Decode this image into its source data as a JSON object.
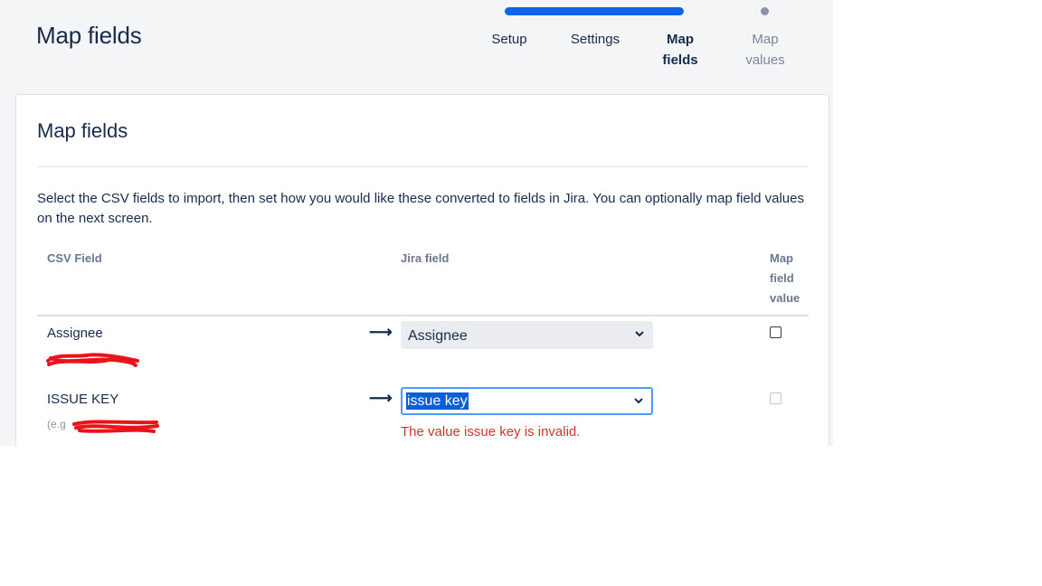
{
  "header": {
    "title": "Map fields"
  },
  "progress": {
    "steps": [
      {
        "label_line1": "Setup",
        "label_line2": "",
        "state": "done"
      },
      {
        "label_line1": "Settings",
        "label_line2": "",
        "state": "done"
      },
      {
        "label_line1": "Map",
        "label_line2": "fields",
        "state": "current"
      },
      {
        "label_line1": "Map",
        "label_line2": "values",
        "state": "upcoming"
      }
    ]
  },
  "card": {
    "title": "Map fields",
    "description": "Select the CSV fields to import, then set how you would like these converted to fields in Jira. You can optionally map field values on the next screen.",
    "columns": {
      "csv_field": "CSV Field",
      "jira_field": "Jira field",
      "map_value_line1": "Map",
      "map_value_line2": "field",
      "map_value_line3": "value"
    },
    "rows": [
      {
        "csv_name": "Assignee",
        "arrow": "⟶",
        "jira_value": "Assignee",
        "map_checked": false,
        "map_enabled": true
      },
      {
        "csv_name": "ISSUE KEY",
        "example_prefix": "(e.g",
        "arrow": "⟶",
        "jira_value": "issue key",
        "map_checked": false,
        "map_enabled": false,
        "error": "The value issue key is invalid."
      }
    ]
  },
  "colors": {
    "accent": "#0c66e4",
    "error": "#c9372c",
    "focus": "#4c9aff",
    "redaction": "#e8141a"
  }
}
